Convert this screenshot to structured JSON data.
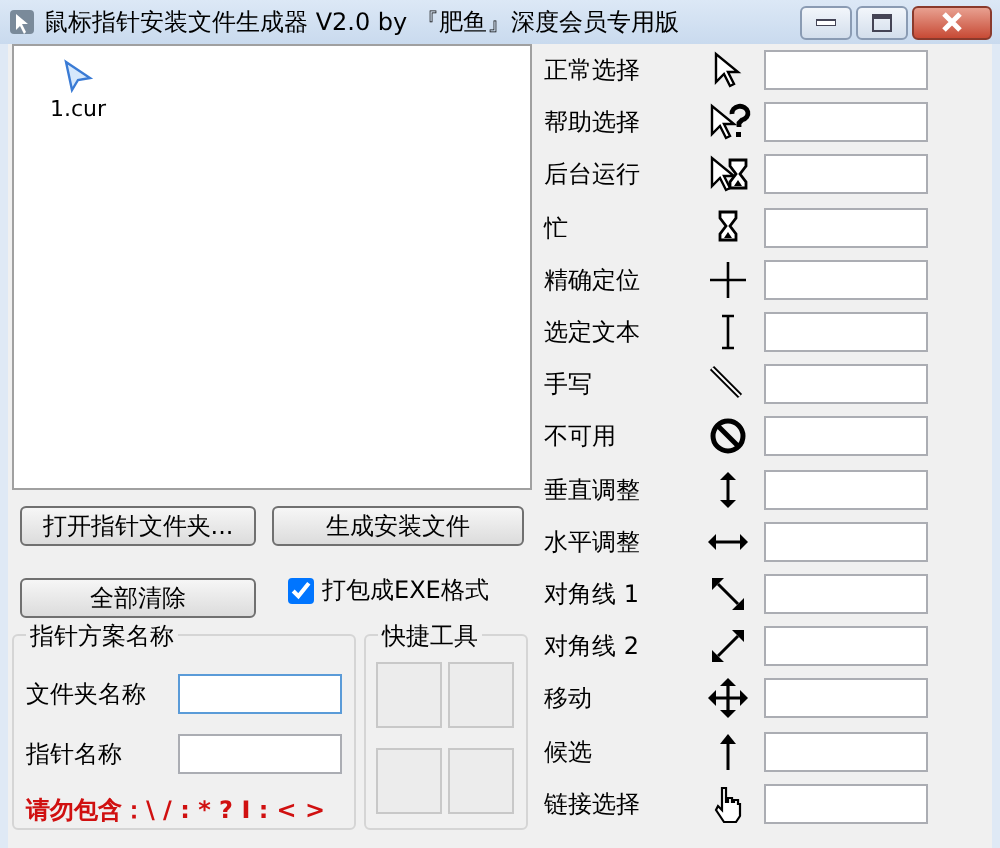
{
  "window": {
    "title": "鼠标指针安装文件生成器 V2.0  by 『肥鱼』深度会员专用版"
  },
  "file_list": {
    "items": [
      {
        "label": "1.cur",
        "selected": false
      }
    ]
  },
  "buttons": [
    {
      "label": "打开指针文件夹..."
    },
    {
      "label": "生成安装文件"
    },
    {
      "label": "全部清除"
    }
  ],
  "pack_exe": {
    "label": "打包成EXE格式",
    "checked": true
  },
  "scheme_group": {
    "title": "指针方案名称",
    "fields": [
      {
        "label": "文件夹名称",
        "focused": true
      },
      {
        "label": "指针名称",
        "focused": false
      }
    ],
    "warning": "请勿包含：\\ / : * ? I : < >"
  },
  "tools_group": {
    "title": "快捷工具"
  },
  "cursors": [
    {
      "label": "正常选择"
    },
    {
      "label": "帮助选择"
    },
    {
      "label": "后台运行"
    },
    {
      "label": "忙"
    },
    {
      "label": "精确定位"
    },
    {
      "label": "选定文本"
    },
    {
      "label": "手写"
    },
    {
      "label": "不可用"
    },
    {
      "label": "垂直调整"
    },
    {
      "label": "水平调整"
    },
    {
      "label": "对角线 1"
    },
    {
      "label": "对角线 2"
    },
    {
      "label": "移动"
    },
    {
      "label": "候选"
    },
    {
      "label": "链接选择"
    }
  ]
}
